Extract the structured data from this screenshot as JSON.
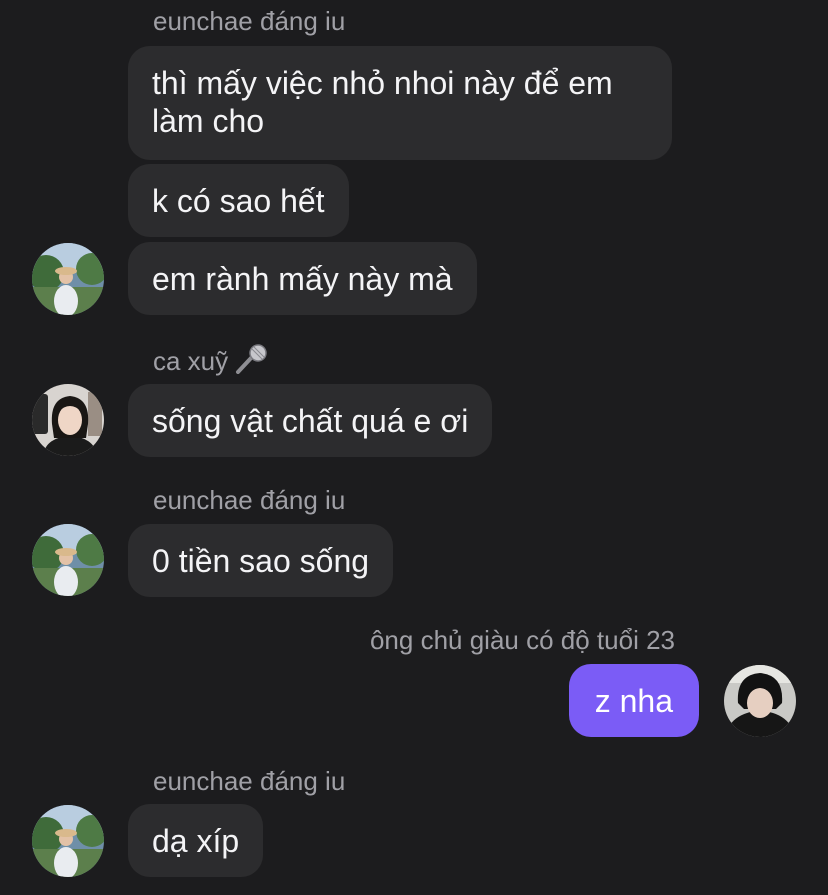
{
  "messages": [
    {
      "sender": "eunchae đáng iu",
      "text": "thì mấy việc nhỏ nhoi này để em làm cho"
    },
    {
      "text": "k có sao hết"
    },
    {
      "text": "em rành mấy này mà"
    },
    {
      "sender": "ca xuỹ",
      "sender_icon": "microphone-icon",
      "text": "sống vật chất quá e ơi"
    },
    {
      "sender": "eunchae đáng iu",
      "text": "0 tiền sao sống"
    },
    {
      "sender": "ông chủ giàu có độ tuổi 23",
      "text": "z nha"
    },
    {
      "sender": "eunchae đáng iu",
      "text": "dạ xíp"
    }
  ],
  "colors": {
    "background": "#1c1c1e",
    "incoming_bubble": "#2c2c2e",
    "outgoing_bubble": "#7b5cf6",
    "sender_label": "#a0a0a6"
  }
}
